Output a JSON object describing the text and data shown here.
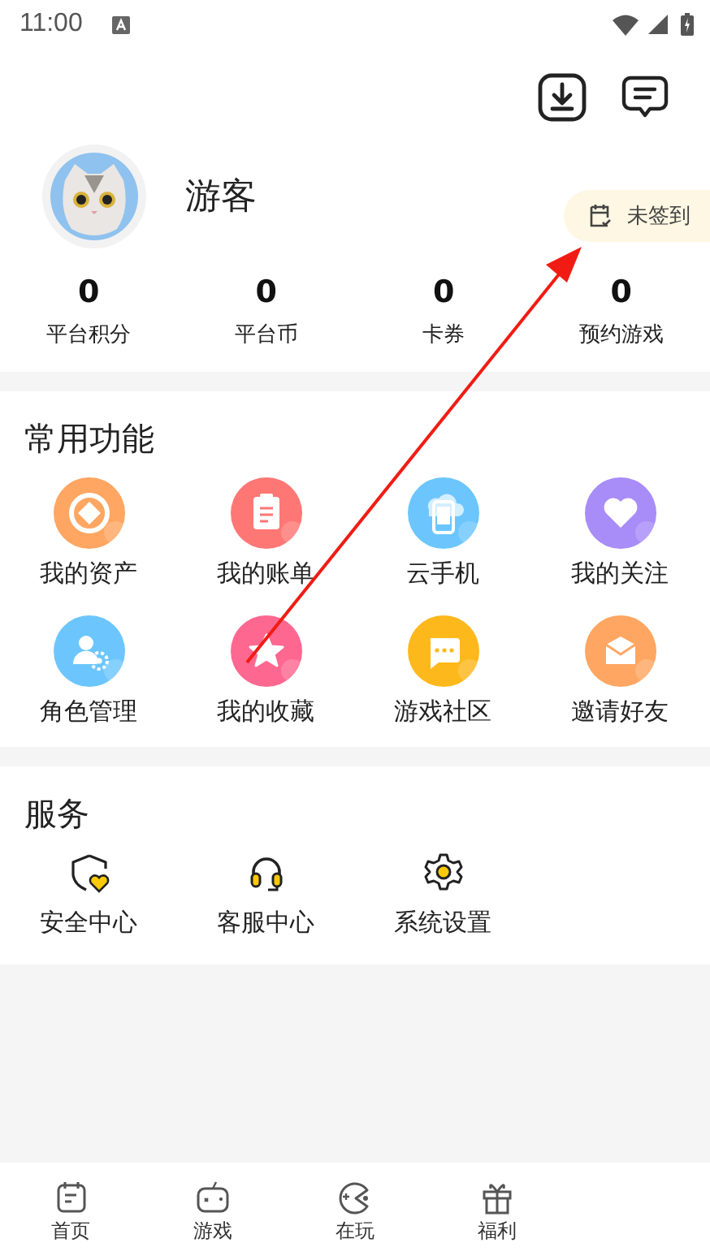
{
  "status_bar": {
    "time": "11:00"
  },
  "profile": {
    "name": "游客",
    "checkin": "未签到"
  },
  "stats": [
    {
      "value": "0",
      "label": "平台积分"
    },
    {
      "value": "0",
      "label": "平台币"
    },
    {
      "value": "0",
      "label": "卡券"
    },
    {
      "value": "0",
      "label": "预约游戏"
    }
  ],
  "common_functions": {
    "title": "常用功能",
    "items": [
      {
        "label": "我的资产",
        "color": "#fea662"
      },
      {
        "label": "我的账单",
        "color": "#fe7775"
      },
      {
        "label": "云手机",
        "color": "#6cc6fd"
      },
      {
        "label": "我的关注",
        "color": "#a88cf8"
      },
      {
        "label": "角色管理",
        "color": "#6cc6fd"
      },
      {
        "label": "我的收藏",
        "color": "#fe6790"
      },
      {
        "label": "游戏社区",
        "color": "#fdb81c"
      },
      {
        "label": "邀请好友",
        "color": "#fea662"
      }
    ]
  },
  "services": {
    "title": "服务",
    "items": [
      {
        "label": "安全中心"
      },
      {
        "label": "客服中心"
      },
      {
        "label": "系统设置"
      }
    ]
  },
  "bottom_nav": [
    {
      "label": "首页"
    },
    {
      "label": "游戏"
    },
    {
      "label": "在玩"
    },
    {
      "label": "福利"
    }
  ]
}
